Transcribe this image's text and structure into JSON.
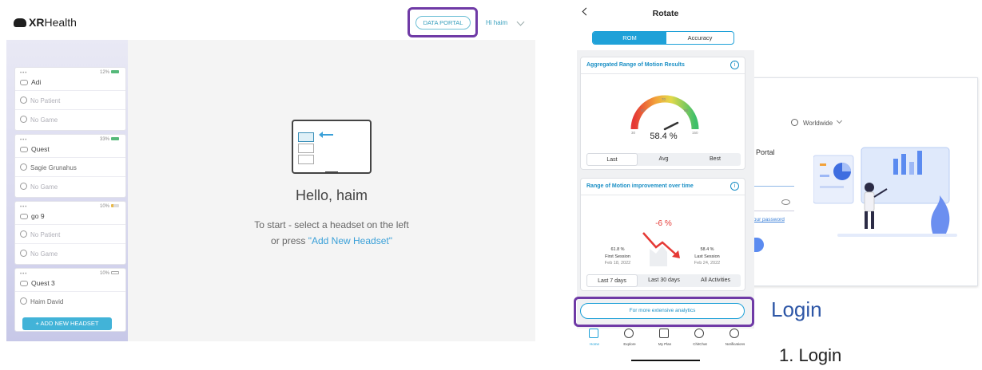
{
  "dashboard": {
    "brand": {
      "bold": "XR",
      "rest": "Health"
    },
    "header": {
      "data_portal_label": "DATA PORTAL",
      "greeting": "Hi haim"
    },
    "headsets": [
      {
        "battery": "12%",
        "name": "Adi",
        "patient": "No Patient",
        "game": "No Game",
        "battery_style": "ok"
      },
      {
        "battery": "33%",
        "name": "Quest",
        "patient": "Sagie Grunahus",
        "game": "No Game",
        "battery_style": "ok"
      },
      {
        "battery": "10%",
        "name": "go 9",
        "patient": "No Patient",
        "game": "No Game",
        "battery_style": "low"
      },
      {
        "battery": "10%",
        "name": "Quest 3",
        "patient": "Haim David",
        "game": "",
        "battery_style": "empty"
      }
    ],
    "add_headset_label": "+ ADD NEW HEADSET",
    "hello": "Hello, haim",
    "start_line1": "To start - select a headset on the left",
    "start_line2_prefix": "or press ",
    "start_line2_link": "\"Add New Headset\""
  },
  "phone": {
    "title": "Rotate",
    "segments": [
      "ROM",
      "Accuracy"
    ],
    "aggregated": {
      "title": "Aggregated Range of Motion Results",
      "info": "i",
      "gauge_ticks": [
        "30",
        "50",
        "70",
        "90",
        "150"
      ],
      "value": "58.4 %",
      "tabs": [
        "Last",
        "Avg",
        "Best"
      ]
    },
    "improvement": {
      "title": "Range of Motion improvement over time",
      "info": "i",
      "change": "-6 %",
      "first": {
        "value": "61.8 %",
        "label": "First Session",
        "date": "Feb 18, 2022"
      },
      "last": {
        "value": "58.4 %",
        "label": "Last Session",
        "date": "Feb 24, 2022"
      },
      "tabs": [
        "Last 7 days",
        "Last 30 days",
        "All Activities"
      ]
    },
    "more_analytics": "For more extensive analytics",
    "nav": [
      "Home",
      "Explore",
      "My Plan",
      "ChitChat",
      "Notifications"
    ]
  },
  "login_screen": {
    "region": "Worldwide",
    "title_fragment": "ta Portal",
    "forgot_fragment": "t your password"
  },
  "labels": {
    "section": "Login",
    "step": "1. Login"
  },
  "colors": {
    "highlight": "#6f3aa6",
    "accent": "#1fa1d8",
    "label_blue": "#2d56a6",
    "alert_red": "#e53935"
  }
}
